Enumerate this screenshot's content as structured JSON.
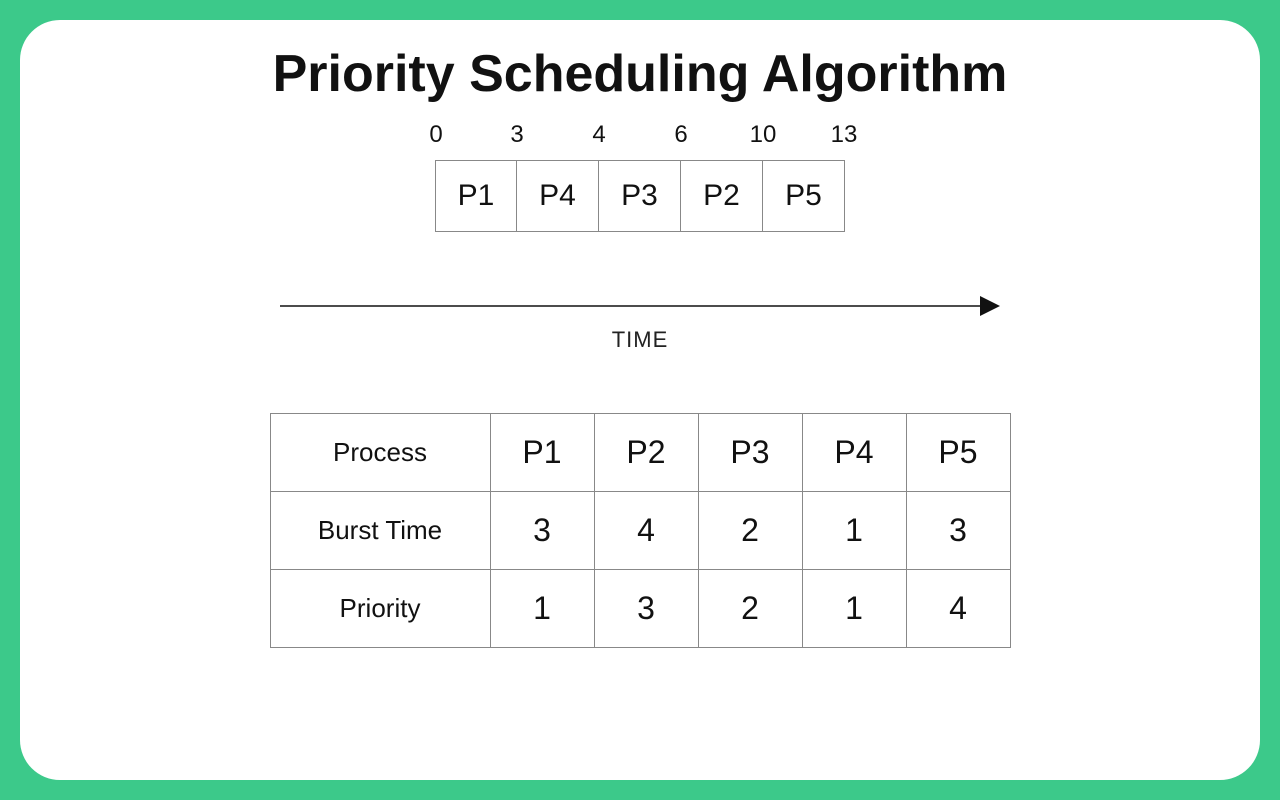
{
  "title": "Priority Scheduling Algorithm",
  "gantt": {
    "segments": [
      {
        "label": "P1",
        "start": "0"
      },
      {
        "label": "P4",
        "start": "3"
      },
      {
        "label": "P3",
        "start": "4"
      },
      {
        "label": "P2",
        "start": "6"
      },
      {
        "label": "P5",
        "start": "10"
      }
    ],
    "end": "13"
  },
  "time_axis_label": "TIME",
  "table": {
    "rows": [
      {
        "label": "Process",
        "values": [
          "P1",
          "P2",
          "P3",
          "P4",
          "P5"
        ]
      },
      {
        "label": "Burst Time",
        "values": [
          "3",
          "4",
          "2",
          "1",
          "3"
        ]
      },
      {
        "label": "Priority",
        "values": [
          "1",
          "3",
          "2",
          "1",
          "4"
        ]
      }
    ]
  },
  "chart_data": {
    "type": "table",
    "title": "Priority Scheduling Algorithm",
    "gantt_order": [
      "P1",
      "P4",
      "P3",
      "P2",
      "P5"
    ],
    "gantt_times": [
      0,
      3,
      4,
      6,
      10,
      13
    ],
    "processes": [
      "P1",
      "P2",
      "P3",
      "P4",
      "P5"
    ],
    "burst_time": [
      3,
      4,
      2,
      1,
      3
    ],
    "priority": [
      1,
      3,
      2,
      1,
      4
    ]
  }
}
